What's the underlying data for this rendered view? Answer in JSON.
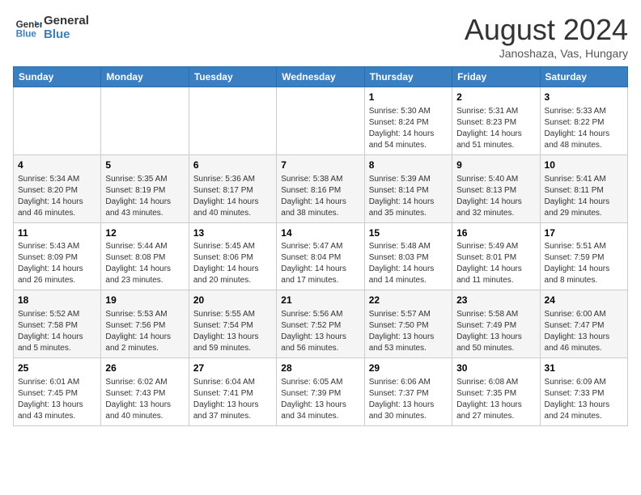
{
  "header": {
    "logo_line1": "General",
    "logo_line2": "Blue",
    "month": "August 2024",
    "location": "Janoshaza, Vas, Hungary"
  },
  "days_of_week": [
    "Sunday",
    "Monday",
    "Tuesday",
    "Wednesday",
    "Thursday",
    "Friday",
    "Saturday"
  ],
  "weeks": [
    [
      {
        "day": "",
        "info": ""
      },
      {
        "day": "",
        "info": ""
      },
      {
        "day": "",
        "info": ""
      },
      {
        "day": "",
        "info": ""
      },
      {
        "day": "1",
        "info": "Sunrise: 5:30 AM\nSunset: 8:24 PM\nDaylight: 14 hours\nand 54 minutes."
      },
      {
        "day": "2",
        "info": "Sunrise: 5:31 AM\nSunset: 8:23 PM\nDaylight: 14 hours\nand 51 minutes."
      },
      {
        "day": "3",
        "info": "Sunrise: 5:33 AM\nSunset: 8:22 PM\nDaylight: 14 hours\nand 48 minutes."
      }
    ],
    [
      {
        "day": "4",
        "info": "Sunrise: 5:34 AM\nSunset: 8:20 PM\nDaylight: 14 hours\nand 46 minutes."
      },
      {
        "day": "5",
        "info": "Sunrise: 5:35 AM\nSunset: 8:19 PM\nDaylight: 14 hours\nand 43 minutes."
      },
      {
        "day": "6",
        "info": "Sunrise: 5:36 AM\nSunset: 8:17 PM\nDaylight: 14 hours\nand 40 minutes."
      },
      {
        "day": "7",
        "info": "Sunrise: 5:38 AM\nSunset: 8:16 PM\nDaylight: 14 hours\nand 38 minutes."
      },
      {
        "day": "8",
        "info": "Sunrise: 5:39 AM\nSunset: 8:14 PM\nDaylight: 14 hours\nand 35 minutes."
      },
      {
        "day": "9",
        "info": "Sunrise: 5:40 AM\nSunset: 8:13 PM\nDaylight: 14 hours\nand 32 minutes."
      },
      {
        "day": "10",
        "info": "Sunrise: 5:41 AM\nSunset: 8:11 PM\nDaylight: 14 hours\nand 29 minutes."
      }
    ],
    [
      {
        "day": "11",
        "info": "Sunrise: 5:43 AM\nSunset: 8:09 PM\nDaylight: 14 hours\nand 26 minutes."
      },
      {
        "day": "12",
        "info": "Sunrise: 5:44 AM\nSunset: 8:08 PM\nDaylight: 14 hours\nand 23 minutes."
      },
      {
        "day": "13",
        "info": "Sunrise: 5:45 AM\nSunset: 8:06 PM\nDaylight: 14 hours\nand 20 minutes."
      },
      {
        "day": "14",
        "info": "Sunrise: 5:47 AM\nSunset: 8:04 PM\nDaylight: 14 hours\nand 17 minutes."
      },
      {
        "day": "15",
        "info": "Sunrise: 5:48 AM\nSunset: 8:03 PM\nDaylight: 14 hours\nand 14 minutes."
      },
      {
        "day": "16",
        "info": "Sunrise: 5:49 AM\nSunset: 8:01 PM\nDaylight: 14 hours\nand 11 minutes."
      },
      {
        "day": "17",
        "info": "Sunrise: 5:51 AM\nSunset: 7:59 PM\nDaylight: 14 hours\nand 8 minutes."
      }
    ],
    [
      {
        "day": "18",
        "info": "Sunrise: 5:52 AM\nSunset: 7:58 PM\nDaylight: 14 hours\nand 5 minutes."
      },
      {
        "day": "19",
        "info": "Sunrise: 5:53 AM\nSunset: 7:56 PM\nDaylight: 14 hours\nand 2 minutes."
      },
      {
        "day": "20",
        "info": "Sunrise: 5:55 AM\nSunset: 7:54 PM\nDaylight: 13 hours\nand 59 minutes."
      },
      {
        "day": "21",
        "info": "Sunrise: 5:56 AM\nSunset: 7:52 PM\nDaylight: 13 hours\nand 56 minutes."
      },
      {
        "day": "22",
        "info": "Sunrise: 5:57 AM\nSunset: 7:50 PM\nDaylight: 13 hours\nand 53 minutes."
      },
      {
        "day": "23",
        "info": "Sunrise: 5:58 AM\nSunset: 7:49 PM\nDaylight: 13 hours\nand 50 minutes."
      },
      {
        "day": "24",
        "info": "Sunrise: 6:00 AM\nSunset: 7:47 PM\nDaylight: 13 hours\nand 46 minutes."
      }
    ],
    [
      {
        "day": "25",
        "info": "Sunrise: 6:01 AM\nSunset: 7:45 PM\nDaylight: 13 hours\nand 43 minutes."
      },
      {
        "day": "26",
        "info": "Sunrise: 6:02 AM\nSunset: 7:43 PM\nDaylight: 13 hours\nand 40 minutes."
      },
      {
        "day": "27",
        "info": "Sunrise: 6:04 AM\nSunset: 7:41 PM\nDaylight: 13 hours\nand 37 minutes."
      },
      {
        "day": "28",
        "info": "Sunrise: 6:05 AM\nSunset: 7:39 PM\nDaylight: 13 hours\nand 34 minutes."
      },
      {
        "day": "29",
        "info": "Sunrise: 6:06 AM\nSunset: 7:37 PM\nDaylight: 13 hours\nand 30 minutes."
      },
      {
        "day": "30",
        "info": "Sunrise: 6:08 AM\nSunset: 7:35 PM\nDaylight: 13 hours\nand 27 minutes."
      },
      {
        "day": "31",
        "info": "Sunrise: 6:09 AM\nSunset: 7:33 PM\nDaylight: 13 hours\nand 24 minutes."
      }
    ]
  ]
}
